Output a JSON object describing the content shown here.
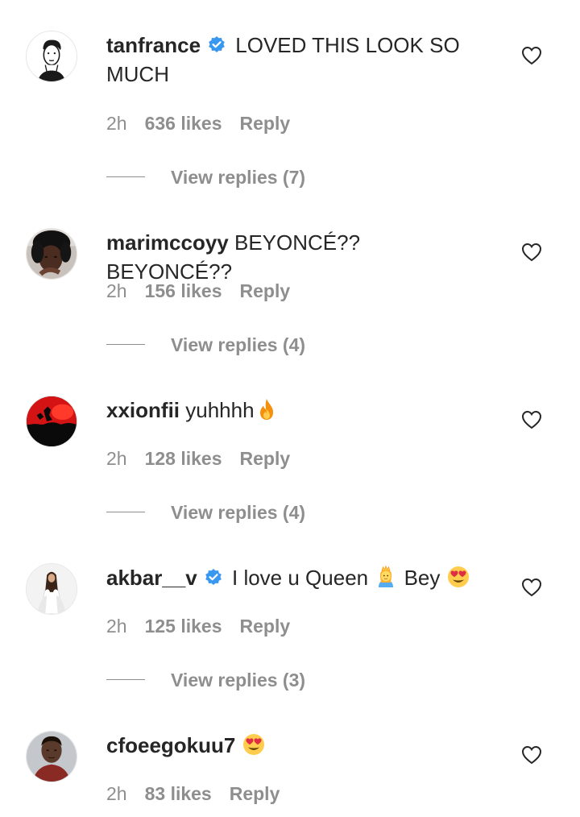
{
  "comments": [
    {
      "username": "tanfrance",
      "verified": true,
      "text": "LOVED THIS LOOK SO MUCH",
      "time": "2h",
      "likes": "636 likes",
      "reply": "Reply",
      "view_replies": "View replies (7)"
    },
    {
      "username": "marimccoyy",
      "verified": false,
      "text": "BEYONCÉ?? BEYONCÉ??",
      "time": "2h",
      "likes": "156 likes",
      "reply": "Reply",
      "view_replies": "View replies (4)"
    },
    {
      "username": "xxionfii",
      "verified": false,
      "text": "yuhhhh",
      "emoji": "fire-emoji",
      "time": "2h",
      "likes": "128 likes",
      "reply": "Reply",
      "view_replies": "View replies (4)"
    },
    {
      "username": "akbar__v",
      "verified": true,
      "text": "I love u Queen",
      "emoji": "princess-emoji",
      "text2": "Bey",
      "emoji2": "heart-eyes-emoji",
      "time": "2h",
      "likes": "125 likes",
      "reply": "Reply",
      "view_replies": "View replies (3)"
    },
    {
      "username": "cfoeegokuu7",
      "verified": false,
      "emoji": "heart-eyes-emoji",
      "time": "2h",
      "likes": "83 likes",
      "reply": "Reply"
    }
  ],
  "colors": {
    "text": "#262626",
    "secondary": "#8e8e8e",
    "verified": "#3897f0"
  },
  "icons": {
    "verified": "verified-badge-icon",
    "like": "heart-outline-icon"
  }
}
